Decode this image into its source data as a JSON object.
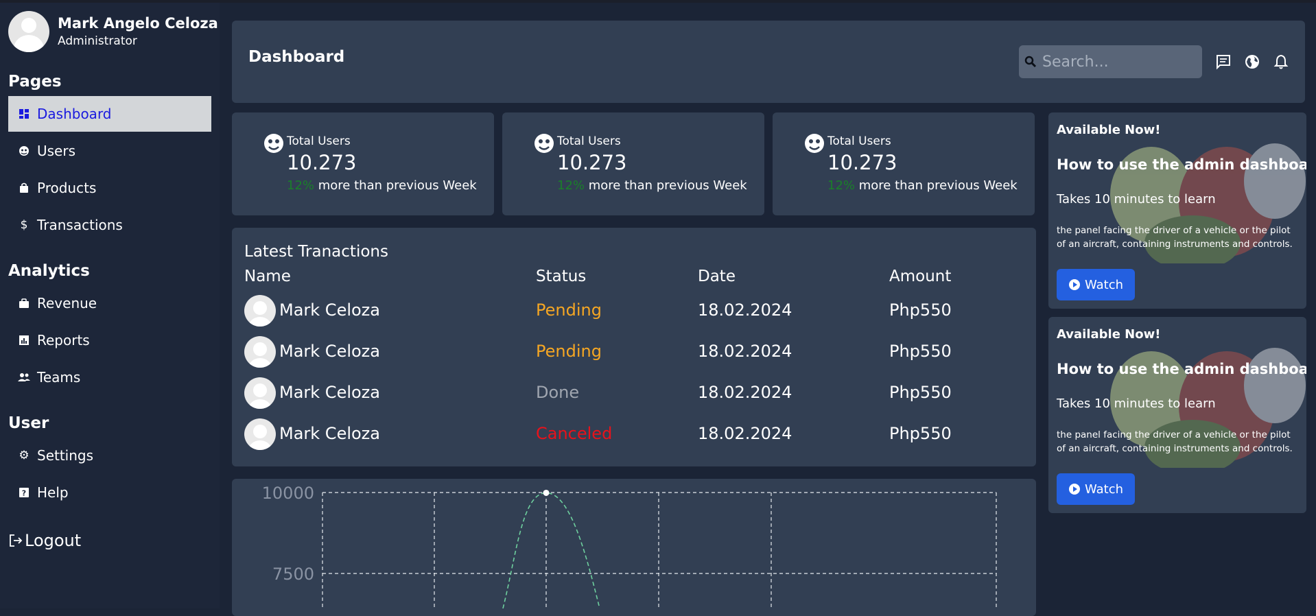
{
  "profile": {
    "name": "Mark Angelo Celoza",
    "role": "Administrator"
  },
  "sidebar": {
    "sections": [
      {
        "title": "Pages",
        "items": [
          {
            "label": "Dashboard",
            "icon": "dashboard-icon",
            "active": true
          },
          {
            "label": "Users",
            "icon": "users-icon"
          },
          {
            "label": "Products",
            "icon": "bag-icon"
          },
          {
            "label": "Transactions",
            "icon": "dollar-icon"
          }
        ]
      },
      {
        "title": "Analytics",
        "items": [
          {
            "label": "Revenue",
            "icon": "briefcase-icon"
          },
          {
            "label": "Reports",
            "icon": "report-icon"
          },
          {
            "label": "Teams",
            "icon": "team-icon"
          }
        ]
      },
      {
        "title": "User",
        "items": [
          {
            "label": "Settings",
            "icon": "gear-icon"
          },
          {
            "label": "Help",
            "icon": "help-icon"
          }
        ]
      }
    ],
    "logout_label": "Logout"
  },
  "header": {
    "title": "Dashboard",
    "search_placeholder": "Search..."
  },
  "stats": [
    {
      "label": "Total Users",
      "value": "10.273",
      "pct": "12%",
      "note": "more than previous Week"
    },
    {
      "label": "Total Users",
      "value": "10.273",
      "pct": "12%",
      "note": "more than previous Week"
    },
    {
      "label": "Total Users",
      "value": "10.273",
      "pct": "12%",
      "note": "more than previous Week"
    }
  ],
  "transactions": {
    "title": "Latest Tranactions",
    "columns": [
      "Name",
      "Status",
      "Date",
      "Amount"
    ],
    "rows": [
      {
        "name": "Mark Celoza",
        "status": "Pending",
        "date": "18.02.2024",
        "amount": "Php550"
      },
      {
        "name": "Mark Celoza",
        "status": "Pending",
        "date": "18.02.2024",
        "amount": "Php550"
      },
      {
        "name": "Mark Celoza",
        "status": "Done",
        "date": "18.02.2024",
        "amount": "Php550"
      },
      {
        "name": "Mark Celoza",
        "status": "Canceled",
        "date": "18.02.2024",
        "amount": "Php550"
      }
    ]
  },
  "status_colors": {
    "Pending": "#f5a623",
    "Done": "#a0a6b0",
    "Canceled": "#e8121b"
  },
  "promos": [
    {
      "kicker": "Available Now!",
      "title": "How to use the admin dashboard",
      "subtitle": "Takes 10 minutes to learn",
      "description": "the panel facing the driver of a vehicle or the pilot of an aircraft, containing instruments and controls.",
      "button": "Watch"
    },
    {
      "kicker": "Available Now!",
      "title": "How to use the admin dashboard",
      "subtitle": "Takes 10 minutes to learn",
      "description": "the panel facing the driver of a vehicle or the pilot of an aircraft, containing instruments and controls.",
      "button": "Watch"
    }
  ],
  "chart_data": {
    "type": "line",
    "y_ticks": [
      "10000",
      "7500"
    ],
    "ylim_visible": [
      6700,
      10000
    ],
    "series": [
      {
        "x": [
          0,
          1,
          2,
          3,
          4,
          5,
          6
        ],
        "values": [
          null,
          6500,
          9990,
          6500,
          null,
          null,
          null
        ]
      }
    ],
    "grid": true,
    "line_color": "#6ecf9e"
  }
}
